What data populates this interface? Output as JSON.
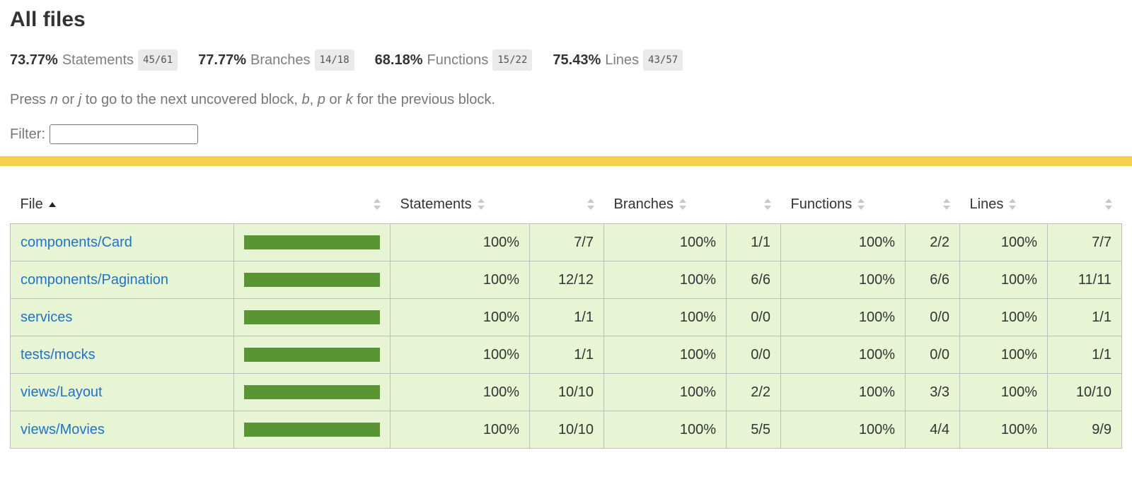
{
  "title": "All files",
  "summary": [
    {
      "pct": "73.77%",
      "name": "Statements",
      "frac": "45/61"
    },
    {
      "pct": "77.77%",
      "name": "Branches",
      "frac": "14/18"
    },
    {
      "pct": "68.18%",
      "name": "Functions",
      "frac": "15/22"
    },
    {
      "pct": "75.43%",
      "name": "Lines",
      "frac": "43/57"
    }
  ],
  "hint": {
    "t1": "Press ",
    "k1": "n",
    "t2": " or ",
    "k2": "j",
    "t3": " to go to the next uncovered block, ",
    "k3": "b",
    "t4": ", ",
    "k4": "p",
    "t5": " or ",
    "k5": "k",
    "t6": " for the previous block."
  },
  "filter": {
    "label": "Filter:",
    "value": ""
  },
  "table": {
    "headers": {
      "file": "File",
      "statements": "Statements",
      "branches": "Branches",
      "functions": "Functions",
      "lines": "Lines"
    },
    "rows": [
      {
        "file": "components/Card",
        "coverage": 1.0,
        "st_pct": "100%",
        "st_frac": "7/7",
        "br_pct": "100%",
        "br_frac": "1/1",
        "fn_pct": "100%",
        "fn_frac": "2/2",
        "ln_pct": "100%",
        "ln_frac": "7/7"
      },
      {
        "file": "components/Pagination",
        "coverage": 1.0,
        "st_pct": "100%",
        "st_frac": "12/12",
        "br_pct": "100%",
        "br_frac": "6/6",
        "fn_pct": "100%",
        "fn_frac": "6/6",
        "ln_pct": "100%",
        "ln_frac": "11/11"
      },
      {
        "file": "services",
        "coverage": 1.0,
        "st_pct": "100%",
        "st_frac": "1/1",
        "br_pct": "100%",
        "br_frac": "0/0",
        "fn_pct": "100%",
        "fn_frac": "0/0",
        "ln_pct": "100%",
        "ln_frac": "1/1"
      },
      {
        "file": "tests/mocks",
        "coverage": 1.0,
        "st_pct": "100%",
        "st_frac": "1/1",
        "br_pct": "100%",
        "br_frac": "0/0",
        "fn_pct": "100%",
        "fn_frac": "0/0",
        "ln_pct": "100%",
        "ln_frac": "1/1"
      },
      {
        "file": "views/Layout",
        "coverage": 1.0,
        "st_pct": "100%",
        "st_frac": "10/10",
        "br_pct": "100%",
        "br_frac": "2/2",
        "fn_pct": "100%",
        "fn_frac": "3/3",
        "ln_pct": "100%",
        "ln_frac": "10/10"
      },
      {
        "file": "views/Movies",
        "coverage": 1.0,
        "st_pct": "100%",
        "st_frac": "10/10",
        "br_pct": "100%",
        "br_frac": "5/5",
        "fn_pct": "100%",
        "fn_frac": "4/4",
        "ln_pct": "100%",
        "ln_frac": "9/9"
      }
    ]
  },
  "colors": {
    "row_bg": "#e7f5d4",
    "bar_fill": "#5a9534",
    "link": "#2173c3",
    "divider": "#f4d24a"
  }
}
